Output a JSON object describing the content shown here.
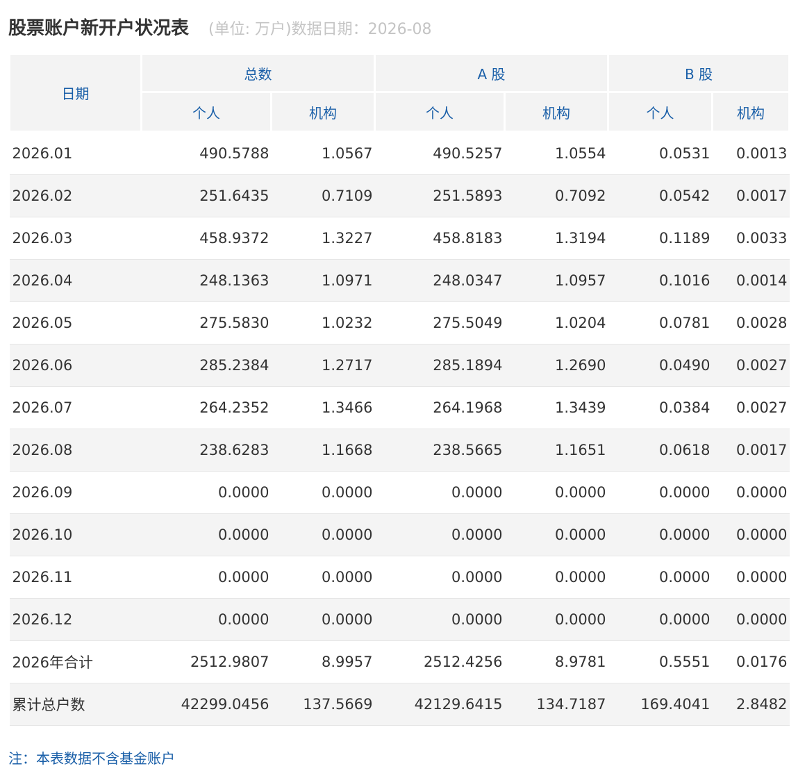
{
  "title": "股票账户新开户状况表",
  "subtitle": "(单位: 万户)数据日期：2026-08",
  "headers": {
    "date": "日期",
    "total": "总数",
    "a_share": "A 股",
    "b_share": "B 股",
    "individual": "个人",
    "institution": "机构"
  },
  "rows": [
    {
      "date": "2026.01",
      "total_ind": "490.5788",
      "total_inst": "1.0567",
      "a_ind": "490.5257",
      "a_inst": "1.0554",
      "b_ind": "0.0531",
      "b_inst": "0.0013"
    },
    {
      "date": "2026.02",
      "total_ind": "251.6435",
      "total_inst": "0.7109",
      "a_ind": "251.5893",
      "a_inst": "0.7092",
      "b_ind": "0.0542",
      "b_inst": "0.0017"
    },
    {
      "date": "2026.03",
      "total_ind": "458.9372",
      "total_inst": "1.3227",
      "a_ind": "458.8183",
      "a_inst": "1.3194",
      "b_ind": "0.1189",
      "b_inst": "0.0033"
    },
    {
      "date": "2026.04",
      "total_ind": "248.1363",
      "total_inst": "1.0971",
      "a_ind": "248.0347",
      "a_inst": "1.0957",
      "b_ind": "0.1016",
      "b_inst": "0.0014"
    },
    {
      "date": "2026.05",
      "total_ind": "275.5830",
      "total_inst": "1.0232",
      "a_ind": "275.5049",
      "a_inst": "1.0204",
      "b_ind": "0.0781",
      "b_inst": "0.0028"
    },
    {
      "date": "2026.06",
      "total_ind": "285.2384",
      "total_inst": "1.2717",
      "a_ind": "285.1894",
      "a_inst": "1.2690",
      "b_ind": "0.0490",
      "b_inst": "0.0027"
    },
    {
      "date": "2026.07",
      "total_ind": "264.2352",
      "total_inst": "1.3466",
      "a_ind": "264.1968",
      "a_inst": "1.3439",
      "b_ind": "0.0384",
      "b_inst": "0.0027"
    },
    {
      "date": "2026.08",
      "total_ind": "238.6283",
      "total_inst": "1.1668",
      "a_ind": "238.5665",
      "a_inst": "1.1651",
      "b_ind": "0.0618",
      "b_inst": "0.0017"
    },
    {
      "date": "2026.09",
      "total_ind": "0.0000",
      "total_inst": "0.0000",
      "a_ind": "0.0000",
      "a_inst": "0.0000",
      "b_ind": "0.0000",
      "b_inst": "0.0000"
    },
    {
      "date": "2026.10",
      "total_ind": "0.0000",
      "total_inst": "0.0000",
      "a_ind": "0.0000",
      "a_inst": "0.0000",
      "b_ind": "0.0000",
      "b_inst": "0.0000"
    },
    {
      "date": "2026.11",
      "total_ind": "0.0000",
      "total_inst": "0.0000",
      "a_ind": "0.0000",
      "a_inst": "0.0000",
      "b_ind": "0.0000",
      "b_inst": "0.0000"
    },
    {
      "date": "2026.12",
      "total_ind": "0.0000",
      "total_inst": "0.0000",
      "a_ind": "0.0000",
      "a_inst": "0.0000",
      "b_ind": "0.0000",
      "b_inst": "0.0000"
    },
    {
      "date": "2026年合计",
      "total_ind": "2512.9807",
      "total_inst": "8.9957",
      "a_ind": "2512.4256",
      "a_inst": "8.9781",
      "b_ind": "0.5551",
      "b_inst": "0.0176"
    },
    {
      "date": "累计总户数",
      "total_ind": "42299.0456",
      "total_inst": "137.5669",
      "a_ind": "42129.6415",
      "a_inst": "134.7187",
      "b_ind": "169.4041",
      "b_inst": "2.8482"
    }
  ],
  "footnote": "注：本表数据不含基金账户",
  "colors": {
    "header_bg": "#f3f3f3",
    "header_text": "#1a5fa8",
    "stripe_bg": "#f4f4f4",
    "body_text": "#333333",
    "subtitle_text": "#c4c4c4"
  }
}
